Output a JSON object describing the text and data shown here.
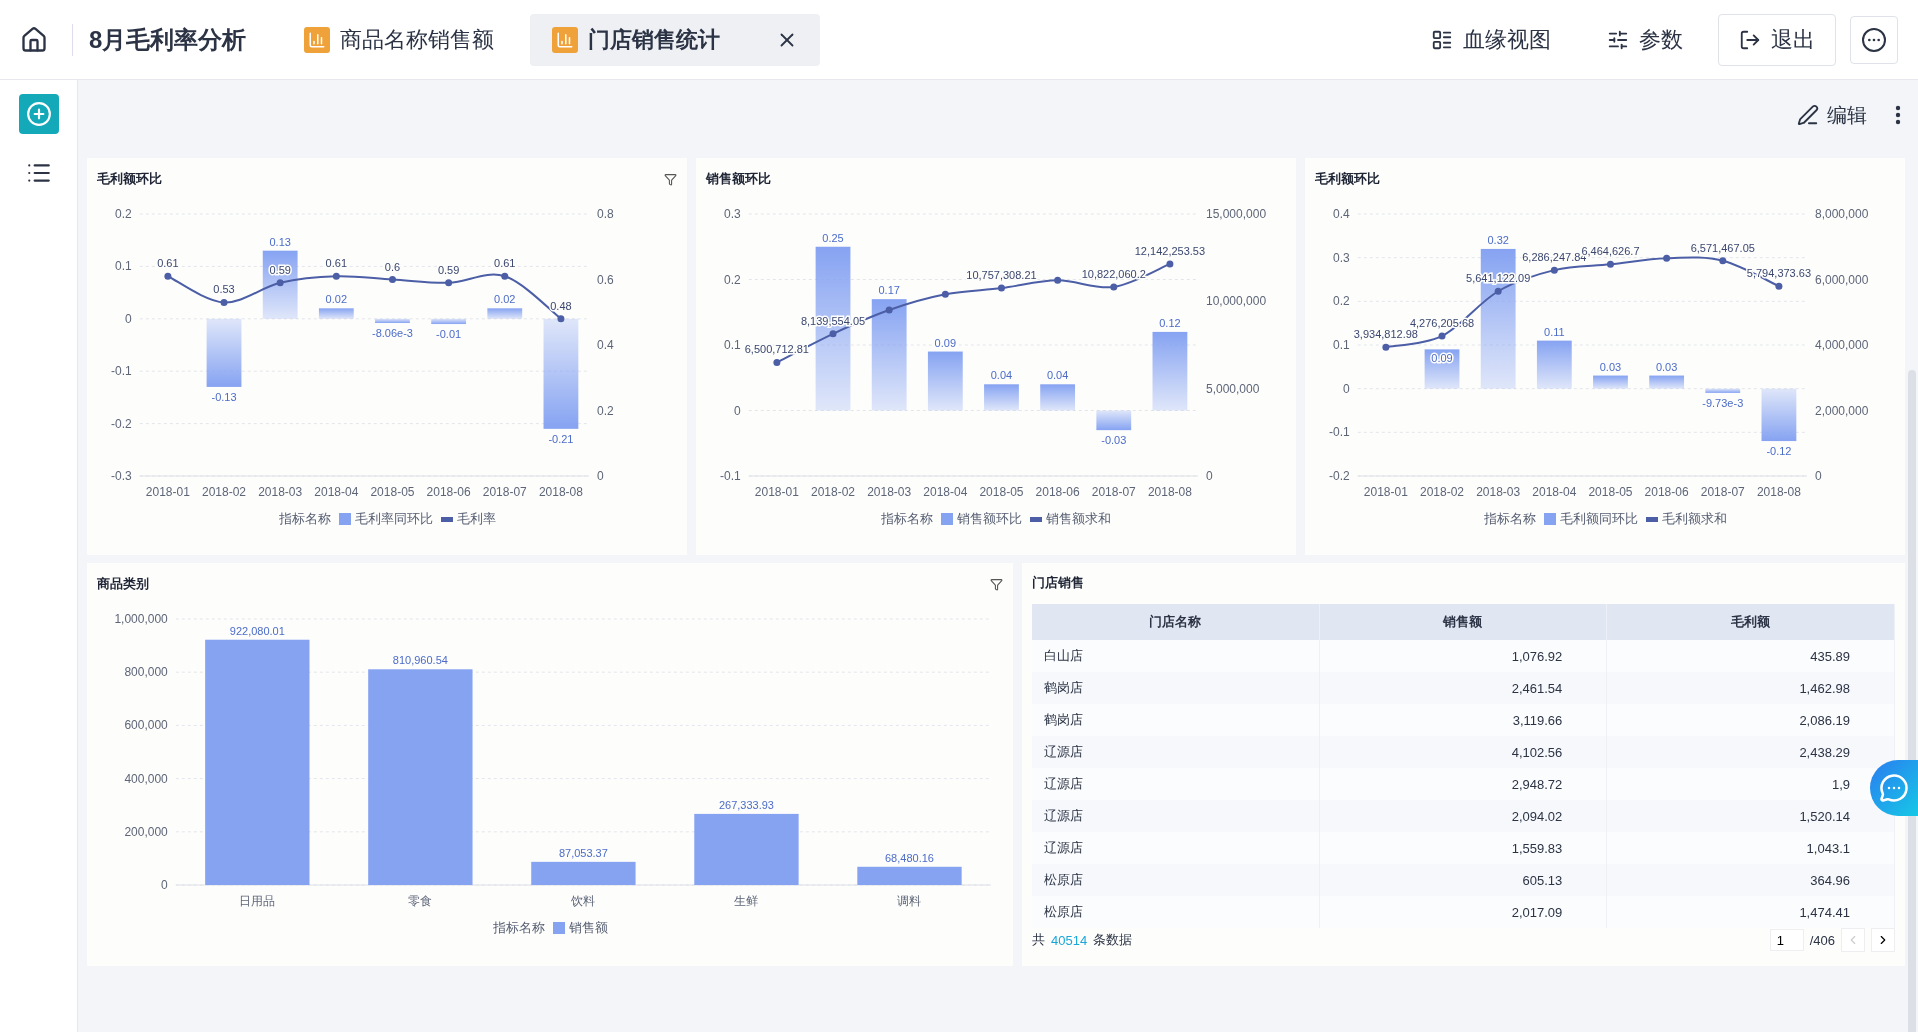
{
  "header": {
    "title": "8月毛利率分析",
    "tabs": [
      {
        "label": "商品名称销售额",
        "selected": false,
        "closable": false
      },
      {
        "label": "门店销售统计",
        "selected": true,
        "closable": true
      }
    ],
    "actions": [
      {
        "label": "血缘视图",
        "kind": "lineage",
        "outlined": false
      },
      {
        "label": "参数",
        "kind": "params",
        "outlined": false
      },
      {
        "label": "退出",
        "kind": "exit",
        "outlined": true
      }
    ]
  },
  "toolbar": {
    "edit_label": "编辑"
  },
  "charts": [
    {
      "title": "毛利额环比",
      "filter": true,
      "legend_title": "指标名称",
      "chart_data": {
        "type": "bar",
        "grid": true,
        "categories": [
          "2018-01",
          "2018-02",
          "2018-03",
          "2018-04",
          "2018-05",
          "2018-06",
          "2018-07",
          "2018-08"
        ],
        "ylim": [
          -0.3,
          0.2
        ],
        "yticks": [
          0.2,
          0.1,
          0,
          -0.1,
          -0.2,
          -0.3
        ],
        "y2lim": [
          0,
          0.8
        ],
        "y2ticks": [
          0.8,
          0.6,
          0.4,
          0.2,
          0
        ],
        "series": [
          {
            "name": "毛利率同环比",
            "color": "#86a3f2",
            "values": [
              null,
              -0.13,
              0.13,
              0.02,
              -0.00806,
              -0.01,
              0.02,
              -0.21
            ]
          },
          {
            "name": "毛利率",
            "type": "line",
            "marker": true,
            "axis": "y2",
            "color": "#4b5ea6",
            "values": [
              0.61,
              0.53,
              0.59,
              0.61,
              0.6,
              0.59,
              0.61,
              0.48
            ]
          }
        ],
        "value_labels": [
          [
            null,
            "-0.13",
            "0.13",
            "0.02",
            "-8.06e-3",
            "-0.01",
            "0.02",
            "-0.21"
          ],
          [
            "0.61",
            "0.53",
            "0.59",
            "0.61",
            "0.6",
            "0.59",
            "0.61",
            "0.48"
          ]
        ]
      }
    },
    {
      "title": "销售额环比",
      "filter": false,
      "legend_title": "指标名称",
      "chart_data": {
        "type": "bar",
        "grid": true,
        "categories": [
          "2018-01",
          "2018-02",
          "2018-03",
          "2018-04",
          "2018-05",
          "2018-06",
          "2018-07",
          "2018-08"
        ],
        "ylim": [
          -0.1,
          0.3
        ],
        "yticks": [
          0.3,
          0.2,
          0.1,
          0,
          -0.1
        ],
        "y2lim": [
          0,
          15000000
        ],
        "y2ticks": [
          {
            "value": 15000000,
            "label": "15,000,000"
          },
          {
            "value": 10000000,
            "label": "10,000,000"
          },
          {
            "value": 5000000,
            "label": "5,000,000"
          },
          0
        ],
        "series": [
          {
            "name": "销售额环比",
            "color": "#86a3f2",
            "values": [
              null,
              0.25,
              0.17,
              0.09,
              0.04,
              0.04,
              -0.03,
              0.12
            ]
          },
          {
            "name": "销售额求和",
            "type": "line",
            "marker": true,
            "axis": "y2",
            "color": "#4b5ea6",
            "values": [
              6500712.81,
              8139554.05,
              9500000,
              10400000,
              10757308.21,
              11200000,
              10822060.2,
              12142253.53
            ]
          }
        ],
        "value_labels": [
          [
            null,
            "0.25",
            "0.17",
            "0.09",
            "0.04",
            "0.04",
            "-0.03",
            "0.12"
          ],
          [
            "6,500,712.81",
            "8,139,554.05",
            null,
            null,
            "10,757,308.21",
            null,
            "10,822,060.2",
            "12,142,253.53"
          ]
        ]
      }
    },
    {
      "title": "毛利额环比",
      "filter": false,
      "legend_title": "指标名称",
      "chart_data": {
        "type": "bar",
        "grid": true,
        "categories": [
          "2018-01",
          "2018-02",
          "2018-03",
          "2018-04",
          "2018-05",
          "2018-06",
          "2018-07",
          "2018-08"
        ],
        "ylim": [
          -0.2,
          0.4
        ],
        "yticks": [
          0.4,
          0.3,
          0.2,
          0.1,
          0,
          -0.1,
          -0.2
        ],
        "y2lim": [
          0,
          8000000
        ],
        "y2ticks": [
          {
            "value": 8000000,
            "label": "8,000,000"
          },
          {
            "value": 6000000,
            "label": "6,000,000"
          },
          {
            "value": 4000000,
            "label": "4,000,000"
          },
          {
            "value": 2000000,
            "label": "2,000,000"
          },
          0
        ],
        "series": [
          {
            "name": "毛利额同环比",
            "color": "#86a3f2",
            "values": [
              null,
              0.09,
              0.32,
              0.11,
              0.03,
              0.03,
              -0.00973,
              -0.12
            ]
          },
          {
            "name": "毛利额求和",
            "type": "line",
            "marker": true,
            "axis": "y2",
            "color": "#4b5ea6",
            "values": [
              3934812.98,
              4276205.68,
              5641122.09,
              6286247.84,
              6464626.7,
              6650000,
              6571467.05,
              5794373.63
            ]
          }
        ],
        "value_labels": [
          [
            null,
            "0.09",
            "0.32",
            "0.11",
            "0.03",
            "0.03",
            "-9.73e-3",
            "-0.12"
          ],
          [
            "3,934,812.98",
            "4,276,205.68",
            "5,641,122.09",
            "6,286,247.84",
            "6,464,626.7",
            null,
            "6,571,467.05",
            "5,794,373.63"
          ]
        ]
      }
    }
  ],
  "category_chart": {
    "title": "商品类别",
    "filter": true,
    "legend_title": "指标名称",
    "chart_data": {
      "type": "bar",
      "grid": true,
      "categories": [
        "日用品",
        "零食",
        "饮料",
        "生鲜",
        "调料"
      ],
      "ylim": [
        0,
        1000000
      ],
      "yticks": [
        {
          "value": 1000000,
          "label": "1,000,000"
        },
        {
          "value": 800000,
          "label": "800,000"
        },
        {
          "value": 600000,
          "label": "600,000"
        },
        {
          "value": 400000,
          "label": "400,000"
        },
        {
          "value": 200000,
          "label": "200,000"
        },
        0
      ],
      "series": [
        {
          "name": "销售额",
          "color": "#86a3f2",
          "values": [
            922080.01,
            810960.54,
            87053.37,
            267333.93,
            68480.16
          ]
        }
      ],
      "value_labels": [
        [
          "922,080.01",
          "810,960.54",
          "87,053.37",
          "267,333.93",
          "68,480.16"
        ]
      ]
    }
  },
  "table": {
    "title": "门店销售",
    "columns": [
      "门店名称",
      "销售额",
      "毛利额"
    ],
    "rows": [
      [
        "白山店",
        "1,076.92",
        "435.89"
      ],
      [
        "鹤岗店",
        "2,461.54",
        "1,462.98"
      ],
      [
        "鹤岗店",
        "3,119.66",
        "2,086.19"
      ],
      [
        "辽源店",
        "4,102.56",
        "2,438.29"
      ],
      [
        "辽源店",
        "2,948.72",
        "1,9"
      ],
      [
        "辽源店",
        "2,094.02",
        "1,520.14"
      ],
      [
        "辽源店",
        "1,559.83",
        "1,043.1"
      ],
      [
        "松原店",
        "605.13",
        "364.96"
      ],
      [
        "松原店",
        "2,017.09",
        "1,474.41"
      ]
    ],
    "footer": {
      "prefix": "共",
      "count": "40514",
      "suffix": "条数据",
      "page": "1",
      "pages": "/406"
    }
  }
}
